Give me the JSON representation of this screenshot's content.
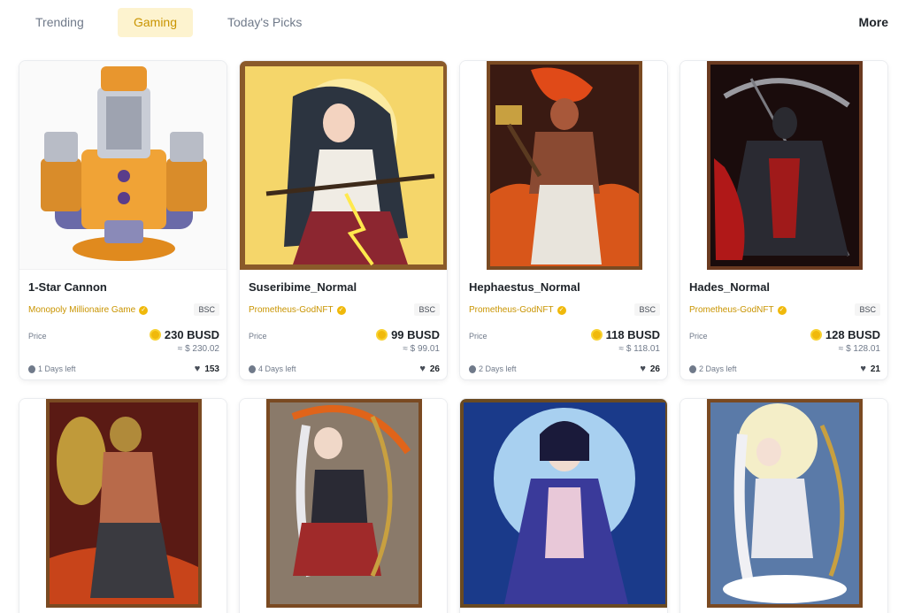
{
  "tabs": [
    {
      "label": "Trending",
      "active": false
    },
    {
      "label": "Gaming",
      "active": true
    },
    {
      "label": "Today's Picks",
      "active": false
    }
  ],
  "more_label": "More",
  "colors": {
    "accent": "#f0b90b",
    "accent_text": "#c99400",
    "active_tab_bg": "#fdf3cf"
  },
  "cards": [
    {
      "name": "1-Star Cannon",
      "creator": "Monopoly Millionaire Game",
      "chain": "BSC",
      "price_label": "Price",
      "price": "230 BUSD",
      "usd": "≈ $ 230.02",
      "time_left": "1 Days left",
      "likes": "153"
    },
    {
      "name": "Suseribime_Normal",
      "creator": "Prometheus-GodNFT",
      "chain": "BSC",
      "price_label": "Price",
      "price": "99 BUSD",
      "usd": "≈ $ 99.01",
      "time_left": "4 Days left",
      "likes": "26"
    },
    {
      "name": "Hephaestus_Normal",
      "creator": "Prometheus-GodNFT",
      "chain": "BSC",
      "price_label": "Price",
      "price": "118 BUSD",
      "usd": "≈ $ 118.01",
      "time_left": "2 Days left",
      "likes": "26"
    },
    {
      "name": "Hades_Normal",
      "creator": "Prometheus-GodNFT",
      "chain": "BSC",
      "price_label": "Price",
      "price": "128 BUSD",
      "usd": "≈ $ 128.01",
      "time_left": "2 Days left",
      "likes": "21"
    }
  ],
  "icons": {
    "verified": "verified-badge-icon",
    "coin": "busd-coin-icon",
    "timer": "timer-icon",
    "like": "heart-icon"
  }
}
